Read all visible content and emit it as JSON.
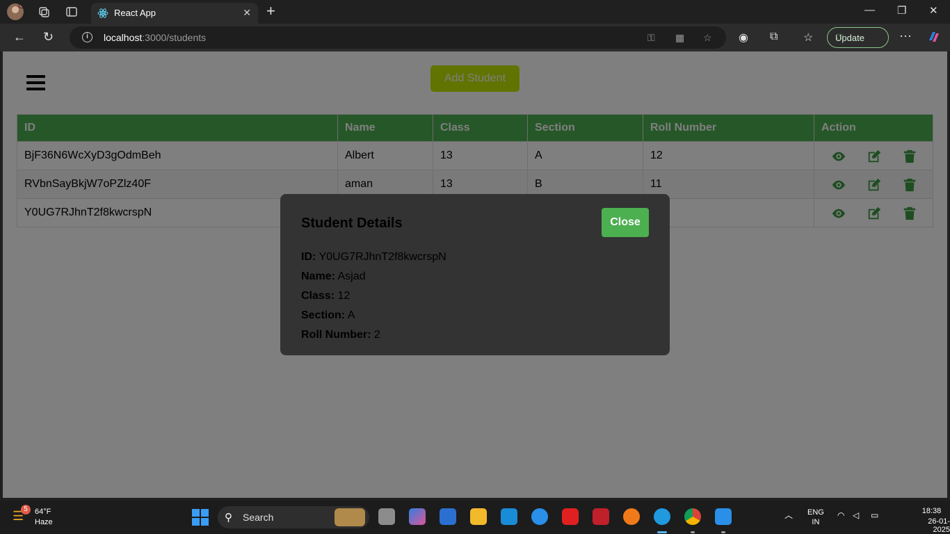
{
  "browser": {
    "tab_title": "React App",
    "url_host": "localhost",
    "url_path": ":3000/students",
    "update_label": "Update"
  },
  "page": {
    "add_button": "Add Student",
    "table": {
      "headers": [
        "ID",
        "Name",
        "Class",
        "Section",
        "Roll Number",
        "Action"
      ],
      "rows": [
        {
          "id": "BjF36N6WcXyD3gOdmBeh",
          "name": "Albert",
          "class": "13",
          "section": "A",
          "roll": "12"
        },
        {
          "id": "RVbnSayBkjW7oPZlz40F",
          "name": "aman",
          "class": "13",
          "section": "B",
          "roll": "11"
        },
        {
          "id": "Y0UG7RJhnT2f8kwcrspN",
          "name": "",
          "class": "",
          "section": "",
          "roll": ""
        }
      ]
    },
    "accent_color": "#4caf50"
  },
  "modal": {
    "title": "Student Details",
    "close_label": "Close",
    "fields": [
      {
        "label": "ID:",
        "value": "Y0UG7RJhnT2f8kwcrspN"
      },
      {
        "label": "Name:",
        "value": "Asjad"
      },
      {
        "label": "Class:",
        "value": "12"
      },
      {
        "label": "Section:",
        "value": "A"
      },
      {
        "label": "Roll Number:",
        "value": "2"
      }
    ]
  },
  "taskbar": {
    "weather_badge": "5",
    "temperature": "64°F",
    "condition": "Haze",
    "search_label": "Search",
    "lang_top": "ENG",
    "lang_bottom": "IN",
    "time": "18:38",
    "date": "26-01-2025"
  }
}
